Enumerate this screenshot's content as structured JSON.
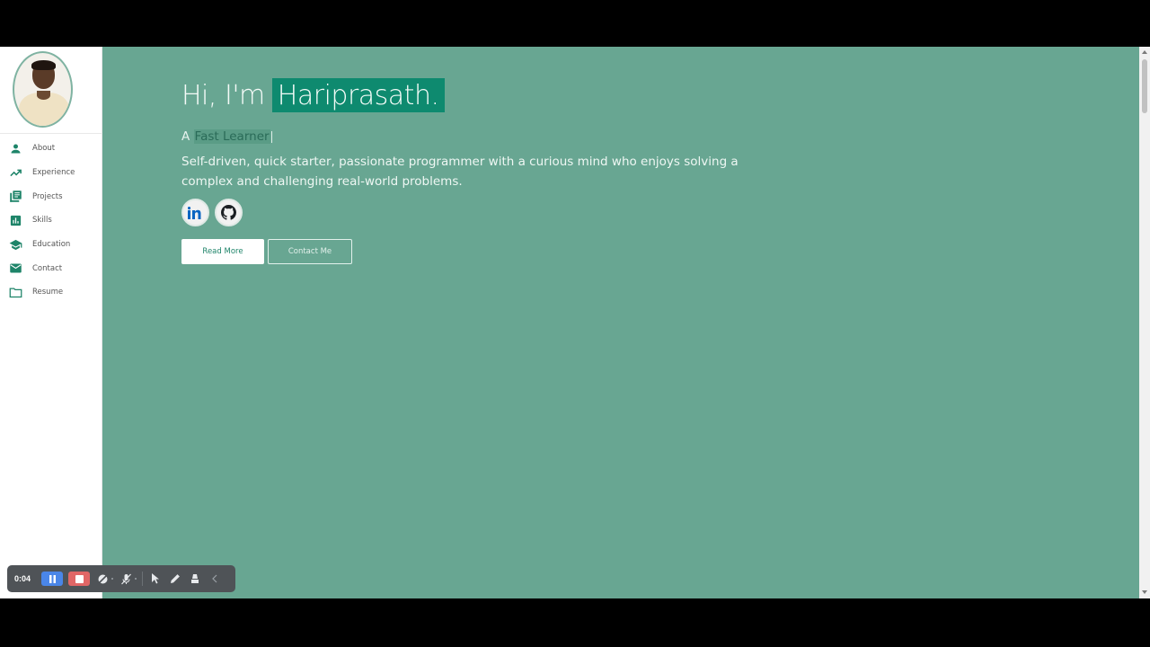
{
  "sidebar": {
    "items": [
      {
        "label": "About",
        "icon": "person-icon"
      },
      {
        "label": "Experience",
        "icon": "trending-up-icon"
      },
      {
        "label": "Projects",
        "icon": "library-books-icon"
      },
      {
        "label": "Skills",
        "icon": "bar-chart-icon"
      },
      {
        "label": "Education",
        "icon": "school-icon"
      },
      {
        "label": "Contact",
        "icon": "mail-icon"
      },
      {
        "label": "Resume",
        "icon": "folder-icon"
      }
    ]
  },
  "hero": {
    "greeting": "Hi, I'm",
    "name": "Hariprasath.",
    "tagline_prefix": "A",
    "role": "Fast Learner",
    "description": "Self-driven, quick starter, passionate programmer with a curious mind who enjoys solving a complex and challenging real-world problems.",
    "read_more_label": "Read More",
    "contact_label": "Contact Me"
  },
  "socials": [
    {
      "name": "linkedin",
      "text": "in"
    },
    {
      "name": "github"
    }
  ],
  "recorder": {
    "time": "0:04"
  },
  "colors": {
    "background": "#68a692",
    "accent": "#0e8a6f",
    "sidebar_icon": "#1e8469"
  }
}
